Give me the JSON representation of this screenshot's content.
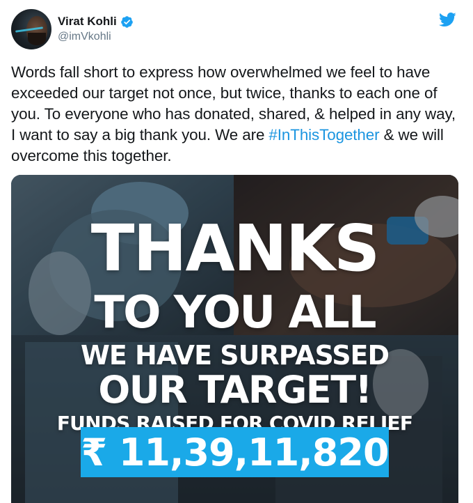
{
  "author": {
    "display_name": "Virat Kohli",
    "handle": "@imVkohli",
    "verified": true,
    "avatar_icon": "avatar-photo"
  },
  "brand": {
    "icon": "twitter-bird-icon",
    "color": "#1da1f2"
  },
  "tweet": {
    "text_part1": "Words fall short to express how overwhelmed we feel to have exceeded our target not once, but twice, thanks to each one of you. To everyone who has donated, shared, & helped in any way, I want to say a big thank you. We are ",
    "hashtag": "#InThisTogether",
    "text_part2": " & we will overcome this together."
  },
  "media": {
    "line1": "THANKS",
    "line2": "TO YOU ALL",
    "line3": "WE HAVE SURPASSED",
    "line4": "OUR TARGET!",
    "line5": "FUNDS RAISED FOR COVID RELIEF",
    "amount": "₹ 11,39,11,820",
    "amount_bg_color": "#1aa9e8"
  },
  "colors": {
    "text": "#14171a",
    "secondary": "#657786",
    "link": "#1b95e0"
  }
}
